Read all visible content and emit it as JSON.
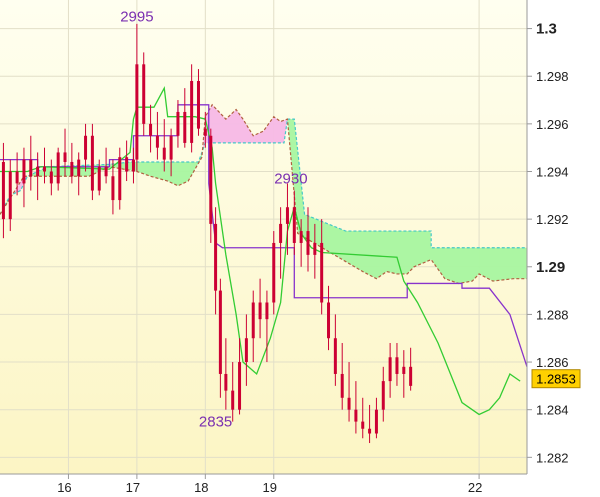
{
  "chart_data": {
    "type": "candlestick",
    "title": "",
    "xlabel": "",
    "ylabel": "",
    "x_ticks": [
      "16",
      "17",
      "18",
      "19",
      "22"
    ],
    "y_ticks": [
      "1.282",
      "1.284",
      "1.286",
      "1.288",
      "1.29",
      "1.292",
      "1.294",
      "1.296",
      "1.298",
      "1.3"
    ],
    "y_major_ticks": [
      "1.29",
      "1.3"
    ],
    "ylim": [
      1.2813,
      1.3012
    ],
    "current_price": "1.2853",
    "annotations": [
      {
        "text": "2995",
        "day": 17.0,
        "price": 1.3003
      },
      {
        "text": "2930",
        "day": 19.25,
        "price": 1.2935
      },
      {
        "text": "2835",
        "day": 18.15,
        "price": 1.2833
      }
    ],
    "colors": {
      "background": "#fefbdc",
      "grid": "#e2dfc8",
      "candle": "#cc0033",
      "green_line": "#33cc33",
      "purple_line": "#8833cc",
      "cloud_bull": "#a8f5a0",
      "cloud_bear": "#f7b8e6",
      "span_a_edge": "#44c8c8",
      "span_b_edge": "#b06040",
      "price_box": "#ffd000"
    },
    "series": [
      {
        "kind": "kijun",
        "color": "purple",
        "points": [
          [
            15.0,
            1.2945
          ],
          [
            15.55,
            1.2945
          ],
          [
            15.55,
            1.2942
          ],
          [
            16.6,
            1.2942
          ],
          [
            16.6,
            1.2945
          ],
          [
            16.95,
            1.2945
          ],
          [
            16.95,
            1.2955
          ],
          [
            17.6,
            1.2955
          ],
          [
            17.6,
            1.2968
          ],
          [
            18.05,
            1.2968
          ],
          [
            18.05,
            1.2935
          ],
          [
            18.15,
            1.291
          ],
          [
            18.25,
            1.2908
          ],
          [
            19.0,
            1.2908
          ],
          [
            19.3,
            1.2908
          ],
          [
            19.3,
            1.2887
          ],
          [
            20.95,
            1.2887
          ],
          [
            20.95,
            1.2893
          ],
          [
            21.75,
            1.2893
          ],
          [
            21.75,
            1.2891
          ],
          [
            22.15,
            1.2891
          ],
          [
            22.45,
            1.288
          ],
          [
            22.7,
            1.2858
          ]
        ]
      },
      {
        "kind": "tenkan",
        "color": "green",
        "points": [
          [
            15.0,
            1.294
          ],
          [
            15.4,
            1.294
          ],
          [
            15.6,
            1.2942
          ],
          [
            16.6,
            1.2941
          ],
          [
            16.9,
            1.2948
          ],
          [
            16.95,
            1.2962
          ],
          [
            17.0,
            1.2967
          ],
          [
            17.25,
            1.2967
          ],
          [
            17.4,
            1.2975
          ],
          [
            17.45,
            1.2963
          ],
          [
            17.85,
            1.2963
          ],
          [
            18.0,
            1.2962
          ],
          [
            18.1,
            1.295
          ],
          [
            18.15,
            1.2935
          ],
          [
            18.3,
            1.2905
          ],
          [
            18.45,
            1.288
          ],
          [
            18.55,
            1.286
          ],
          [
            18.75,
            1.2855
          ],
          [
            18.95,
            1.287
          ],
          [
            19.1,
            1.2885
          ],
          [
            19.2,
            1.2915
          ],
          [
            19.3,
            1.2925
          ],
          [
            19.4,
            1.2914
          ],
          [
            19.55,
            1.2908
          ],
          [
            19.7,
            1.2906
          ],
          [
            20.8,
            1.2904
          ],
          [
            20.9,
            1.2894
          ],
          [
            21.1,
            1.2885
          ],
          [
            21.4,
            1.2868
          ],
          [
            21.75,
            1.2843
          ],
          [
            22.0,
            1.2838
          ],
          [
            22.15,
            1.284
          ],
          [
            22.3,
            1.2845
          ],
          [
            22.45,
            1.2855
          ],
          [
            22.6,
            1.2852
          ]
        ]
      },
      {
        "kind": "span_a",
        "color": "cyan",
        "points": [
          [
            15.0,
            1.2922
          ],
          [
            15.15,
            1.293
          ],
          [
            15.3,
            1.2932
          ],
          [
            15.4,
            1.2938
          ],
          [
            15.7,
            1.2942
          ],
          [
            16.6,
            1.2943
          ],
          [
            16.9,
            1.2944
          ],
          [
            17.9,
            1.2944
          ],
          [
            18.0,
            1.2952
          ],
          [
            19.15,
            1.2952
          ],
          [
            19.2,
            1.2962
          ],
          [
            19.3,
            1.2962
          ],
          [
            19.45,
            1.2922
          ],
          [
            20.05,
            1.2915
          ],
          [
            20.9,
            1.2915
          ],
          [
            21.3,
            1.2915
          ],
          [
            21.3,
            1.2908
          ],
          [
            22.7,
            1.2908
          ]
        ]
      },
      {
        "kind": "span_b",
        "color": "brown",
        "points": [
          [
            15.0,
            1.2922
          ],
          [
            15.35,
            1.2938
          ],
          [
            16.3,
            1.2938
          ],
          [
            16.6,
            1.2942
          ],
          [
            17.0,
            1.294
          ],
          [
            17.2,
            1.2938
          ],
          [
            17.45,
            1.2936
          ],
          [
            17.6,
            1.2934
          ],
          [
            17.75,
            1.2936
          ],
          [
            17.95,
            1.2946
          ],
          [
            18.0,
            1.2963
          ],
          [
            18.1,
            1.2968
          ],
          [
            18.3,
            1.2962
          ],
          [
            18.45,
            1.2966
          ],
          [
            18.55,
            1.2962
          ],
          [
            18.7,
            1.2955
          ],
          [
            18.85,
            1.2957
          ],
          [
            19.0,
            1.2963
          ],
          [
            19.1,
            1.2961
          ],
          [
            19.2,
            1.2962
          ],
          [
            19.35,
            1.2914
          ],
          [
            20.3,
            1.2898
          ],
          [
            20.5,
            1.2895
          ],
          [
            20.65,
            1.2898
          ],
          [
            20.8,
            1.2897
          ],
          [
            20.95,
            1.2897
          ],
          [
            21.05,
            1.29
          ],
          [
            21.3,
            1.2903
          ],
          [
            21.5,
            1.2895
          ],
          [
            21.7,
            1.2893
          ],
          [
            21.9,
            1.2894
          ],
          [
            22.0,
            1.2897
          ],
          [
            22.2,
            1.2894
          ],
          [
            22.5,
            1.2895
          ],
          [
            22.7,
            1.2895
          ]
        ]
      }
    ],
    "candles": [
      [
        15.05,
        1.2944,
        1.2952,
        1.2912,
        1.292
      ],
      [
        15.15,
        1.292,
        1.2945,
        1.2915,
        1.294
      ],
      [
        15.25,
        1.294,
        1.2948,
        1.293,
        1.2935
      ],
      [
        15.35,
        1.2935,
        1.295,
        1.2925,
        1.2945
      ],
      [
        15.45,
        1.2945,
        1.2955,
        1.2932,
        1.2938
      ],
      [
        15.55,
        1.2938,
        1.2948,
        1.2928,
        1.2942
      ],
      [
        15.65,
        1.2942,
        1.295,
        1.2935,
        1.294
      ],
      [
        15.75,
        1.294,
        1.2945,
        1.293,
        1.2935
      ],
      [
        15.85,
        1.2935,
        1.295,
        1.2932,
        1.2948
      ],
      [
        15.95,
        1.2948,
        1.2958,
        1.2938,
        1.2944
      ],
      [
        16.05,
        1.2944,
        1.2952,
        1.2935,
        1.2938
      ],
      [
        16.15,
        1.2938,
        1.2948,
        1.293,
        1.2945
      ],
      [
        16.25,
        1.2945,
        1.296,
        1.294,
        1.2955
      ],
      [
        16.35,
        1.2955,
        1.296,
        1.2928,
        1.2932
      ],
      [
        16.45,
        1.2932,
        1.2945,
        1.293,
        1.2942
      ],
      [
        16.55,
        1.2942,
        1.295,
        1.2935,
        1.2938
      ],
      [
        16.65,
        1.2938,
        1.2945,
        1.2922,
        1.2928
      ],
      [
        16.75,
        1.2928,
        1.295,
        1.2924,
        1.2946
      ],
      [
        16.85,
        1.2946,
        1.2953,
        1.2936,
        1.294
      ],
      [
        16.95,
        1.294,
        1.295,
        1.2935,
        1.2945
      ],
      [
        17.0,
        1.2945,
        1.3002,
        1.294,
        1.2985
      ],
      [
        17.1,
        1.2985,
        1.299,
        1.2955,
        1.296
      ],
      [
        17.2,
        1.296,
        1.2968,
        1.2948,
        1.2955
      ],
      [
        17.3,
        1.2955,
        1.2965,
        1.2945,
        1.295
      ],
      [
        17.4,
        1.295,
        1.2962,
        1.294,
        1.2945
      ],
      [
        17.5,
        1.2945,
        1.2958,
        1.2938,
        1.2955
      ],
      [
        17.6,
        1.2955,
        1.297,
        1.295,
        1.2965
      ],
      [
        17.7,
        1.2965,
        1.2975,
        1.295,
        1.2952
      ],
      [
        17.8,
        1.2952,
        1.2985,
        1.2948,
        1.2978
      ],
      [
        17.9,
        1.2978,
        1.2983,
        1.2955,
        1.2958
      ],
      [
        18.0,
        1.2958,
        1.2965,
        1.295,
        1.2955
      ],
      [
        18.08,
        1.2955,
        1.2958,
        1.291,
        1.2918
      ],
      [
        18.15,
        1.2918,
        1.2925,
        1.288,
        1.289
      ],
      [
        18.22,
        1.289,
        1.2895,
        1.2845,
        1.2855
      ],
      [
        18.3,
        1.2855,
        1.287,
        1.284,
        1.2848
      ],
      [
        18.4,
        1.2848,
        1.286,
        1.2835,
        1.284
      ],
      [
        18.5,
        1.284,
        1.287,
        1.2838,
        1.286
      ],
      [
        18.6,
        1.286,
        1.288,
        1.285,
        1.287
      ],
      [
        18.7,
        1.287,
        1.289,
        1.286,
        1.2885
      ],
      [
        18.8,
        1.2885,
        1.2895,
        1.287,
        1.2878
      ],
      [
        18.9,
        1.2878,
        1.289,
        1.286,
        1.2885
      ],
      [
        19.0,
        1.2885,
        1.2915,
        1.288,
        1.291
      ],
      [
        19.1,
        1.291,
        1.2925,
        1.2895,
        1.2918
      ],
      [
        19.2,
        1.2918,
        1.2935,
        1.2905,
        1.2925
      ],
      [
        19.3,
        1.2925,
        1.2932,
        1.2905,
        1.291
      ],
      [
        19.4,
        1.291,
        1.292,
        1.29,
        1.2915
      ],
      [
        19.5,
        1.2915,
        1.2925,
        1.2898,
        1.2905
      ],
      [
        19.6,
        1.2905,
        1.2918,
        1.2895,
        1.291
      ],
      [
        19.7,
        1.291,
        1.292,
        1.288,
        1.2885
      ],
      [
        19.8,
        1.2885,
        1.2892,
        1.2865,
        1.287
      ],
      [
        19.9,
        1.287,
        1.288,
        1.285,
        1.2855
      ],
      [
        20.0,
        1.2855,
        1.2868,
        1.284,
        1.2845
      ],
      [
        20.1,
        1.2845,
        1.286,
        1.2835,
        1.284
      ],
      [
        20.2,
        1.284,
        1.2852,
        1.283,
        1.2835
      ],
      [
        20.3,
        1.2835,
        1.2845,
        1.2828,
        1.2832
      ],
      [
        20.4,
        1.2832,
        1.2842,
        1.2826,
        1.283
      ],
      [
        20.5,
        1.283,
        1.2845,
        1.2828,
        1.284
      ],
      [
        20.6,
        1.284,
        1.2858,
        1.2835,
        1.2852
      ],
      [
        20.7,
        1.2852,
        1.2868,
        1.2845,
        1.2862
      ],
      [
        20.8,
        1.2862,
        1.2868,
        1.285,
        1.2855
      ],
      [
        20.9,
        1.2855,
        1.2865,
        1.2845,
        1.2858
      ],
      [
        21.0,
        1.2858,
        1.2866,
        1.2848,
        1.285
      ]
    ]
  }
}
